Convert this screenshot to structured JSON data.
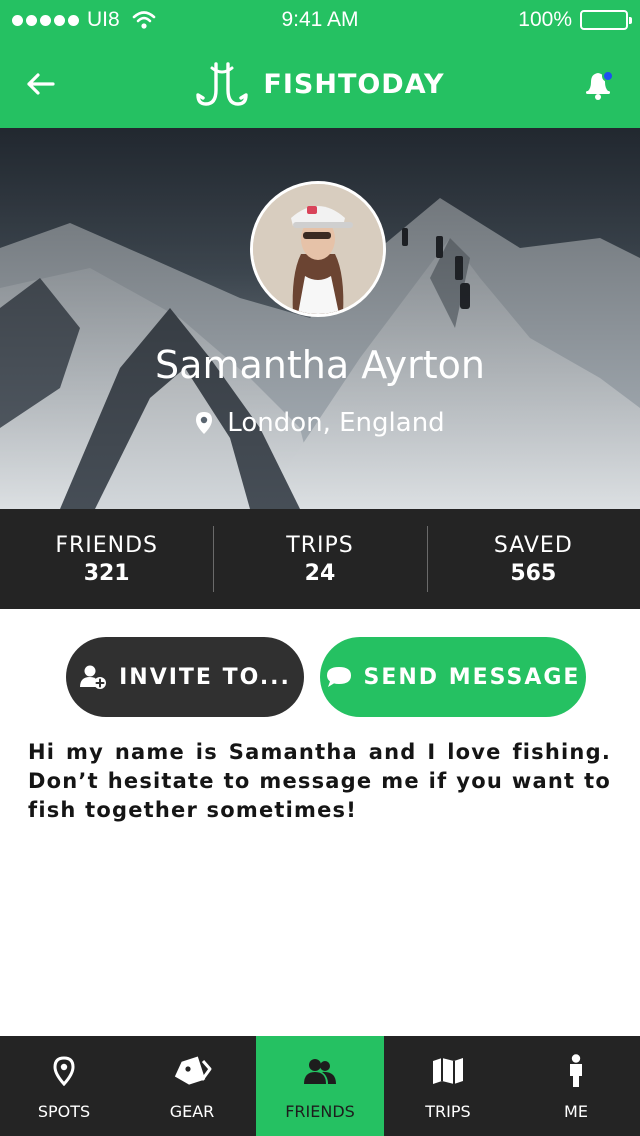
{
  "status_bar": {
    "carrier": "UI8",
    "time": "9:41 AM",
    "battery": "100%"
  },
  "nav": {
    "title": "FISHTODAY",
    "back_icon": "arrow-left-icon",
    "notification_icon": "bell-icon"
  },
  "profile": {
    "name": "Samantha Ayrton",
    "location": "London, England"
  },
  "stats": [
    {
      "label": "FRIENDS",
      "value": "321"
    },
    {
      "label": "TRIPS",
      "value": "24"
    },
    {
      "label": "SAVED",
      "value": "565"
    }
  ],
  "actions": {
    "invite_label": "INVITE TO...",
    "message_label": "SEND MESSAGE"
  },
  "bio": "Hi my name is Samantha and I love fishing. Don’t hesitate to message me if you want to fish together sometimes!",
  "tabs": [
    {
      "label": "SPOTS",
      "icon": "map-pin-icon"
    },
    {
      "label": "GEAR",
      "icon": "tag-icon"
    },
    {
      "label": "FRIENDS",
      "icon": "users-icon"
    },
    {
      "label": "TRIPS",
      "icon": "map-icon"
    },
    {
      "label": "ME",
      "icon": "person-icon"
    }
  ],
  "active_tab": "FRIENDS",
  "colors": {
    "accent": "#25c162",
    "dark": "#242424",
    "button_dark": "#303030",
    "notification_dot": "#1f4ff0"
  }
}
